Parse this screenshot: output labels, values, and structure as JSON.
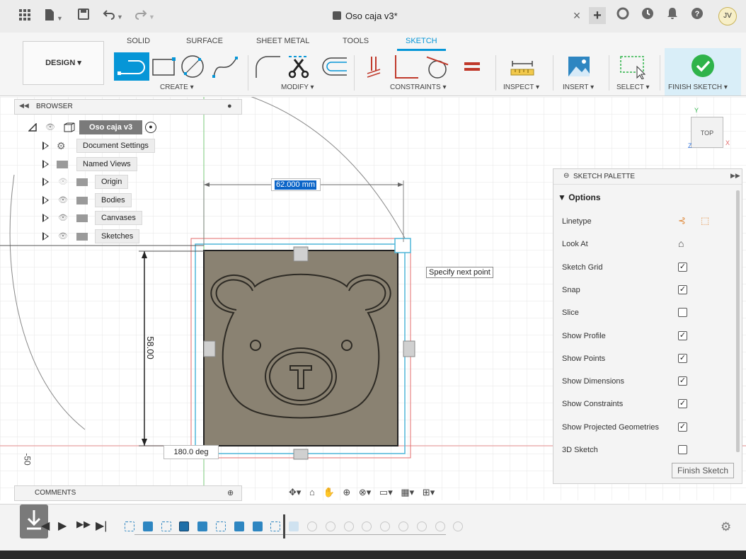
{
  "titlebar": {
    "doc_title": "Oso caja v3*",
    "close_tab": "×",
    "plus": "+",
    "avatar_initials": "JV"
  },
  "ribbon": {
    "tabs": [
      "SOLID",
      "SURFACE",
      "SHEET METAL",
      "TOOLS",
      "SKETCH"
    ],
    "design_label": "DESIGN ▾",
    "groups": {
      "create": "CREATE ▾",
      "modify": "MODIFY ▾",
      "constraints": "CONSTRAINTS ▾",
      "inspect": "INSPECT ▾",
      "insert": "INSERT ▾",
      "select": "SELECT ▾",
      "finish": "FINISH SKETCH ▾"
    }
  },
  "browser": {
    "header": "BROWSER",
    "root": "Oso caja v3",
    "items": [
      "Document Settings",
      "Named Views",
      "Origin",
      "Bodies",
      "Canvases",
      "Sketches"
    ]
  },
  "viewport": {
    "dimension_width": "62.000 mm",
    "dimension_height": "58.00",
    "angle": "180.0 deg",
    "tooltip": "Specify next point",
    "axis_label": "-50",
    "viewcube": "TOP",
    "axis_x": "X",
    "axis_y": "Y",
    "axis_z": "Z"
  },
  "palette": {
    "header": "SKETCH PALETTE",
    "section": "▼ Options",
    "rows": [
      {
        "label": "Linetype",
        "kind": "icons"
      },
      {
        "label": "Look At",
        "kind": "icon"
      },
      {
        "label": "Sketch Grid",
        "checked": true
      },
      {
        "label": "Snap",
        "checked": true
      },
      {
        "label": "Slice",
        "checked": false
      },
      {
        "label": "Show Profile",
        "checked": true
      },
      {
        "label": "Show Points",
        "checked": true
      },
      {
        "label": "Show Dimensions",
        "checked": true
      },
      {
        "label": "Show Constraints",
        "checked": true
      },
      {
        "label": "Show Projected Geometries",
        "checked": true
      },
      {
        "label": "3D Sketch",
        "checked": false
      }
    ],
    "finish_button": "Finish Sketch"
  },
  "comments": {
    "header": "COMMENTS"
  },
  "colors": {
    "accent": "#0696d7",
    "finish_green": "#2fb34a",
    "body_fill": "#8a8272"
  }
}
